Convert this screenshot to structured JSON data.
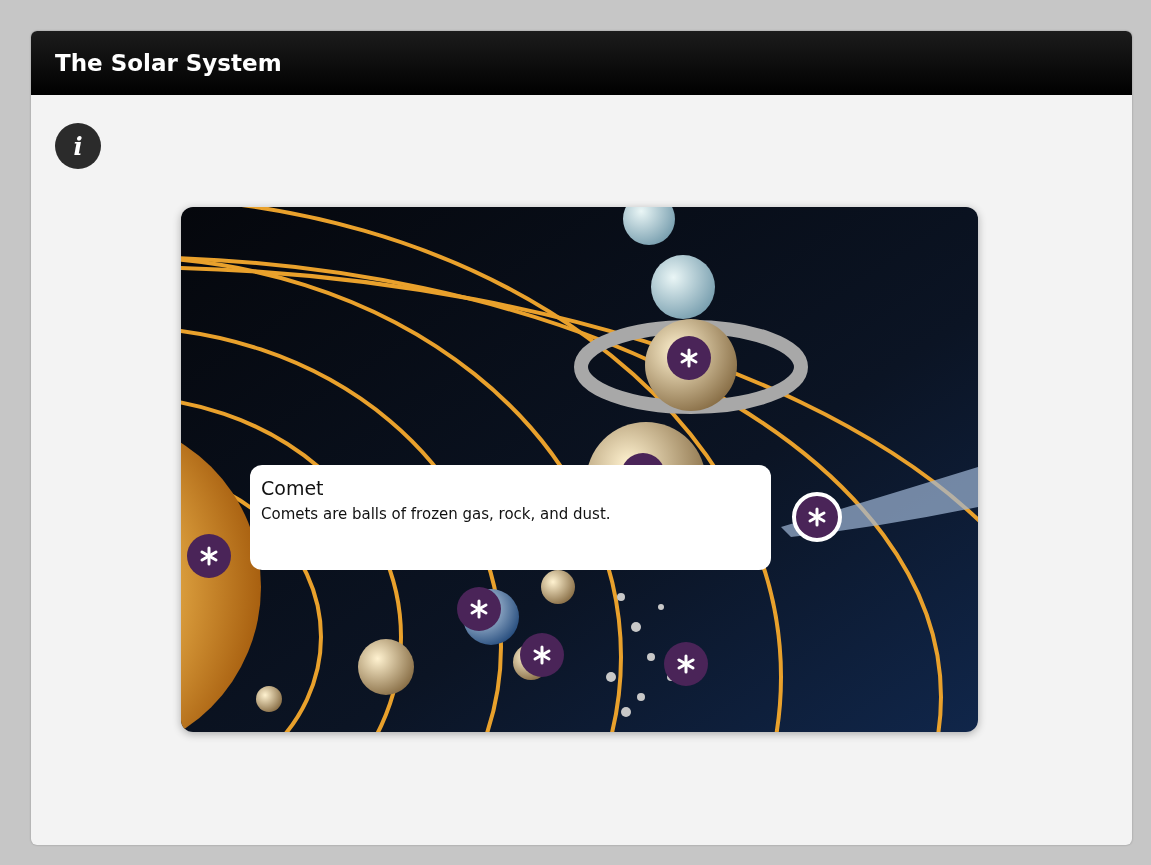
{
  "header": {
    "title": "The Solar System"
  },
  "info_button": {
    "label": "i"
  },
  "hotspots": [
    {
      "selected": false
    },
    {
      "selected": false
    },
    {
      "selected": true
    },
    {
      "selected": false
    },
    {
      "selected": false
    },
    {
      "selected": false
    },
    {
      "selected": false
    }
  ],
  "callout": {
    "title": "Comet",
    "text": "Comets are balls of frozen gas, rock, and dust."
  }
}
